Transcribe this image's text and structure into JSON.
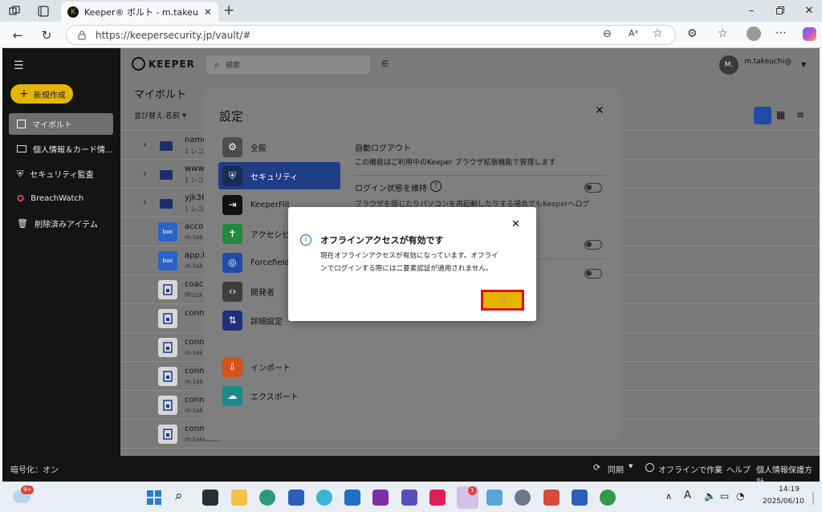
{
  "browser": {
    "tab_title": "Keeper® ボルト - m.takeuchi@",
    "url": "https://keepersecurity.jp/vault/#",
    "new_tab_symbol": "+",
    "window_controls": [
      "minimize-icon",
      "restore-icon",
      "close-icon"
    ]
  },
  "header": {
    "logo_text": "KEEPER",
    "search_placeholder": "検索",
    "user_initial": "M.",
    "user_name": "m.takeuchi@"
  },
  "sidebar": {
    "new_button": "新規作成",
    "items": [
      {
        "label": "マイボルト",
        "icon": "vault-icon",
        "selected": true
      },
      {
        "label": "個人情報＆カード情...",
        "icon": "card-icon",
        "selected": false
      },
      {
        "label": "セキュリティ監査",
        "icon": "shield-icon",
        "selected": false
      },
      {
        "label": "BreachWatch",
        "icon": "breachwatch-icon",
        "selected": false
      },
      {
        "label": "削除済みアイテム",
        "icon": "trash-icon",
        "selected": false
      }
    ]
  },
  "vault": {
    "title": "マイボルト",
    "sort_label": "並び替え 名前",
    "rows": [
      {
        "type": "folder",
        "title": "name",
        "subtitle": "1 レコ"
      },
      {
        "type": "folder",
        "title": "www",
        "subtitle": "1 レコ"
      },
      {
        "type": "folder",
        "title": "yjk36",
        "subtitle": "1 レコ"
      },
      {
        "type": "box",
        "icon_text": "box",
        "title": "accou",
        "subtitle": "m.tak"
      },
      {
        "type": "box",
        "icon_text": "box",
        "title": "app.b",
        "subtitle": "m.tak"
      },
      {
        "type": "record",
        "title": "coach",
        "subtitle": "Mizuk"
      },
      {
        "type": "record",
        "title": "conn",
        "subtitle": ""
      },
      {
        "type": "record",
        "title": "conn",
        "subtitle": "m.tak"
      },
      {
        "type": "record",
        "title": "conn",
        "subtitle": "m.tak"
      },
      {
        "type": "record",
        "title": "conn",
        "subtitle": "m.tak"
      },
      {
        "type": "record",
        "title": "connpass.com",
        "subtitle": "m.takeuchi"
      }
    ]
  },
  "footer": {
    "encryption": "暗号化：オン",
    "sync": "同期",
    "offline": "オフラインで作業",
    "help": "ヘルプ",
    "privacy": "個人情報保護方針"
  },
  "settings": {
    "title": "設定",
    "menu": [
      {
        "label": "全般",
        "color": "#4d4d4d"
      },
      {
        "label": "セキュリティ",
        "color": "#1b2a55",
        "selected": true
      },
      {
        "label": "KeeperFill",
        "color": "#111111"
      },
      {
        "label": "アクセシビ",
        "color": "#1f8a3a"
      },
      {
        "label": "Forcefield",
        "color": "#1f4aa8"
      },
      {
        "label": "開発者",
        "color": "#3d3d3d"
      },
      {
        "label": "詳細設定",
        "color": "#1f2f7a"
      },
      {
        "label": "インポート",
        "color": "#d4531a"
      },
      {
        "label": "エクスポート",
        "color": "#1a8a8a"
      }
    ],
    "auto_logout_title": "自動ログアウト",
    "auto_logout_desc": "この機能はご利用中のKeeper ブラウザ拡張機能で管理します",
    "stay_logged_in_title": "ログイン状態を維持",
    "stay_logged_in_desc": "ブラウザを閉じたりパソコンを再起動したりする場合でもKeeperへログ"
  },
  "alert": {
    "title": "オフラインアクセスが有効です",
    "body_line1": "現在オフラインアクセスが有効になっています。オフライ",
    "body_line2": "ンでログインする際には二要素認証が適用されません。",
    "ok_label": ""
  },
  "taskbar": {
    "weather_badge": "9+",
    "teams_badge": "1",
    "time": "14:19",
    "date": "2025/06/10",
    "ime": "A"
  }
}
